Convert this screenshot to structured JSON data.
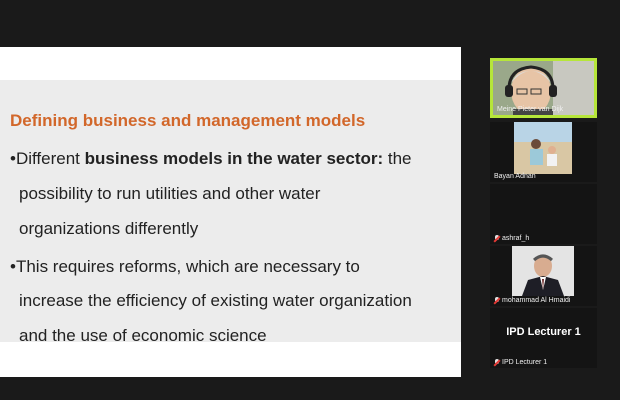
{
  "slide": {
    "title": "Defining business and management models",
    "bullet1_prefix": "•Different ",
    "bullet1_bold": "business models in the water sector:",
    "bullet1_rest": " the",
    "bullet1_line2": "possibility to run utilities and other water",
    "bullet1_line3": "organizations differently",
    "bullet2_line1": "•This requires reforms, which are necessary to",
    "bullet2_line2": "increase the efficiency of existing water organization",
    "bullet2_line3": "and the use of economic science",
    "title_color": "#d2672a"
  },
  "participants": [
    {
      "name": "Meine Pieter van Dijk",
      "active": true,
      "video": "person-headset"
    },
    {
      "name": "Bayan Adnan",
      "video": "photo-beach"
    },
    {
      "name": "ashraf_h",
      "muted": true
    },
    {
      "name": "mohammad Al Hmaidi",
      "muted": true,
      "video": "person-suit"
    },
    {
      "name": "IPD Lecturer 1",
      "display_label": "IPD Lecturer 1",
      "muted": true
    }
  ],
  "colors": {
    "active_speaker_border": "#b6e63a",
    "muted_mic": "#e53935"
  }
}
